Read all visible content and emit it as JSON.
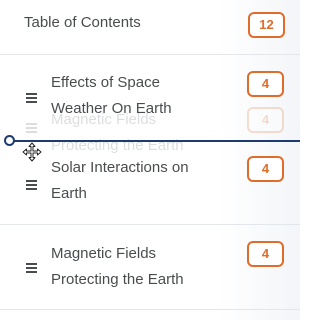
{
  "header": {
    "title": "Table of Contents",
    "count": "12"
  },
  "items": [
    {
      "label": "Effects of Space Weather On Earth",
      "count": "4"
    },
    {
      "label": "Solar Interactions on Earth",
      "count": "4"
    },
    {
      "label": "Magnetic Fields Protecting the Earth",
      "count": "4"
    }
  ],
  "drag_ghost": {
    "label": "Magnetic Fields Protecting the Earth",
    "count": "4"
  },
  "icons": {
    "drag_handle": "drag-handle-icon",
    "cursor": "move-cursor-icon",
    "drop_marker": "drop-indicator"
  },
  "colors": {
    "accent": "#e06c2b",
    "text": "#494c4e",
    "drop_indicator": "#1d3b6e",
    "divider": "#e3e6ea"
  }
}
